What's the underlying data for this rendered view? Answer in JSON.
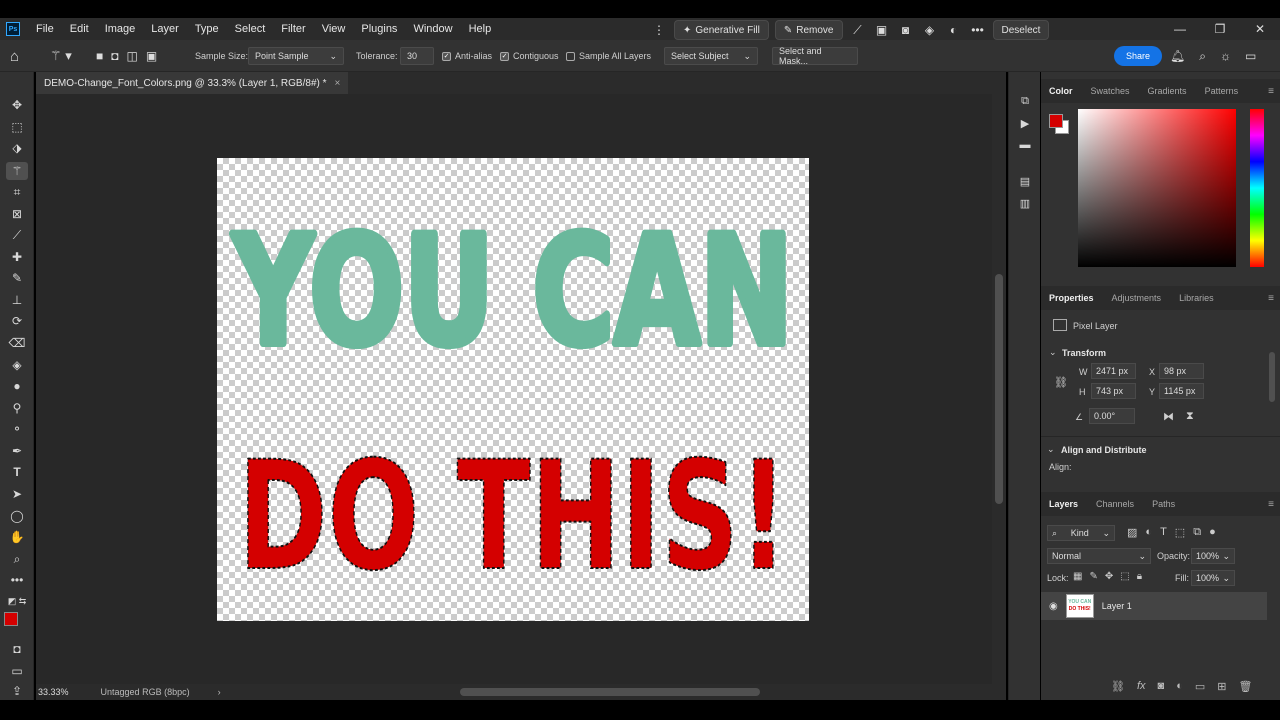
{
  "app": {
    "logo": "Ps"
  },
  "menu": [
    "File",
    "Edit",
    "Image",
    "Layer",
    "Type",
    "Select",
    "Filter",
    "View",
    "Plugins",
    "Window",
    "Help"
  ],
  "window_controls": [
    "—",
    "❐",
    "✕"
  ],
  "contextual_bar": {
    "generative_fill": "Generative Fill",
    "remove": "Remove",
    "deselect": "Deselect",
    "more": "•••"
  },
  "options": {
    "sample_size_label": "Sample Size:",
    "sample_size_value": "Point Sample",
    "tolerance_label": "Tolerance:",
    "tolerance_value": "30",
    "anti_alias": "Anti-alias",
    "contiguous": "Contiguous",
    "sample_all_layers": "Sample All Layers",
    "select_subject": "Select Subject",
    "select_and_mask": "Select and Mask...",
    "share": "Share"
  },
  "document": {
    "tab_title": "DEMO-Change_Font_Colors.png @ 33.3% (Layer 1, RGB/8#) *",
    "close": "×",
    "line1": "YOU CAN",
    "line2": "DO THIS!",
    "line1_color": "#6ab89c",
    "line2_color": "#d40000"
  },
  "status": {
    "zoom": "33.33%",
    "profile": "Untagged RGB (8bpc)",
    "arrow": "›"
  },
  "color_panel": {
    "tabs": [
      "Color",
      "Swatches",
      "Gradients",
      "Patterns"
    ],
    "active_tab": "Color",
    "foreground": "#d40000",
    "background": "#ffffff"
  },
  "properties_panel": {
    "tabs": [
      "Properties",
      "Adjustments",
      "Libraries"
    ],
    "active_tab": "Properties",
    "layer_type": "Pixel Layer",
    "transform_title": "Transform",
    "w_label": "W",
    "w_value": "2471 px",
    "h_label": "H",
    "h_value": "743 px",
    "x_label": "X",
    "x_value": "98 px",
    "y_label": "Y",
    "y_value": "1145 px",
    "angle_value": "0.00°",
    "align_title": "Align and Distribute",
    "align_label": "Align:"
  },
  "layers_panel": {
    "tabs": [
      "Layers",
      "Channels",
      "Paths"
    ],
    "active_tab": "Layers",
    "kind": "Kind",
    "blend_mode": "Normal",
    "opacity_label": "Opacity:",
    "opacity_value": "100%",
    "lock_label": "Lock:",
    "fill_label": "Fill:",
    "fill_value": "100%",
    "layers": [
      {
        "name": "Layer 1",
        "visible": true
      }
    ],
    "footer_fx": "fx"
  },
  "colors": {
    "accent_blue": "#1473e6",
    "panel_bg": "#323232",
    "canvas_bg": "#282828"
  }
}
